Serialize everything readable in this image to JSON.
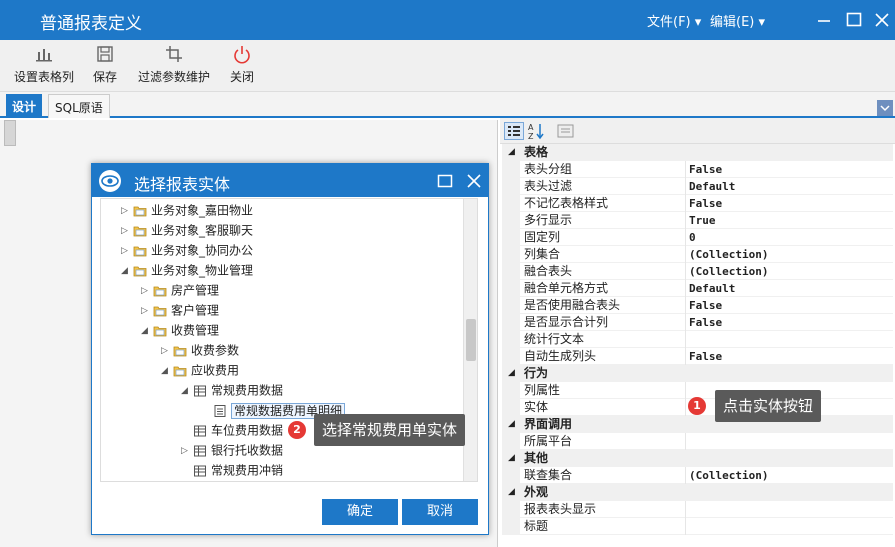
{
  "window": {
    "title": "普通报表定义",
    "menu_file": "文件(F)",
    "menu_edit": "编辑(E)"
  },
  "toolbar": {
    "set_table_columns": "设置表格列",
    "save": "保存",
    "filter_params": "过滤参数维护",
    "close": "关闭"
  },
  "tabs": [
    {
      "label": "设计"
    },
    {
      "label": "SQL原语"
    }
  ],
  "dialog": {
    "title": "选择报表实体",
    "tree": [
      {
        "label": "业务对象_嘉田物业",
        "expander": "▷",
        "icon": "folder"
      },
      {
        "label": "业务对象_客服聊天",
        "expander": "▷",
        "icon": "folder"
      },
      {
        "label": "业务对象_协同办公",
        "expander": "▷",
        "icon": "folder"
      },
      {
        "label": "业务对象_物业管理",
        "expander": "◢",
        "icon": "folder"
      },
      {
        "label": "房产管理",
        "expander": "▷",
        "icon": "folder"
      },
      {
        "label": "客户管理",
        "expander": "▷",
        "icon": "folder"
      },
      {
        "label": "收费管理",
        "expander": "◢",
        "icon": "folder"
      },
      {
        "label": "收费参数",
        "expander": "▷",
        "icon": "folder"
      },
      {
        "label": "应收费用",
        "expander": "◢",
        "icon": "folder"
      },
      {
        "label": "常规费用数据",
        "expander": "◢",
        "icon": "table"
      },
      {
        "label": "常规数据费用单明细",
        "expander": "",
        "icon": "doc"
      },
      {
        "label": "车位费用数据",
        "expander": "",
        "icon": "table"
      },
      {
        "label": "银行托收数据",
        "expander": "▷",
        "icon": "table"
      },
      {
        "label": "常规费用冲销",
        "expander": "",
        "icon": "table"
      }
    ],
    "ok_label": "确定",
    "cancel_label": "取消"
  },
  "callouts": [
    {
      "number": "1",
      "text": "点击实体按钮"
    },
    {
      "number": "2",
      "text": "选择常规费用单实体"
    }
  ],
  "properties": [
    {
      "kind": "category",
      "name": "表格"
    },
    {
      "kind": "item",
      "name": "表头分组",
      "value": "False"
    },
    {
      "kind": "item",
      "name": "表头过滤",
      "value": "Default"
    },
    {
      "kind": "item",
      "name": "不记忆表格样式",
      "value": "False"
    },
    {
      "kind": "item",
      "name": "多行显示",
      "value": "True"
    },
    {
      "kind": "item",
      "name": "固定列",
      "value": "0"
    },
    {
      "kind": "item",
      "name": "列集合",
      "value": "(Collection)"
    },
    {
      "kind": "item",
      "name": "融合表头",
      "value": "(Collection)"
    },
    {
      "kind": "item",
      "name": "融合单元格方式",
      "value": "Default"
    },
    {
      "kind": "item",
      "name": "是否使用融合表头",
      "value": "False"
    },
    {
      "kind": "item",
      "name": "是否显示合计列",
      "value": "False"
    },
    {
      "kind": "item",
      "name": "统计行文本",
      "value": ""
    },
    {
      "kind": "item",
      "name": "自动生成列头",
      "value": "False"
    },
    {
      "kind": "category",
      "name": "行为"
    },
    {
      "kind": "item",
      "name": "列属性",
      "value": ""
    },
    {
      "kind": "item",
      "name": "实体",
      "value": ""
    },
    {
      "kind": "category",
      "name": "界面调用"
    },
    {
      "kind": "item",
      "name": "所属平台",
      "value": ""
    },
    {
      "kind": "category",
      "name": "其他"
    },
    {
      "kind": "item",
      "name": "联查集合",
      "value": "(Collection)"
    },
    {
      "kind": "category",
      "name": "外观"
    },
    {
      "kind": "item",
      "name": "报表表头显示",
      "value": ""
    },
    {
      "kind": "item",
      "name": "标题",
      "value": ""
    }
  ],
  "colors": {
    "accent": "#1e78c8",
    "badge": "#e53935",
    "callout_bg": "#5a5a5a"
  }
}
